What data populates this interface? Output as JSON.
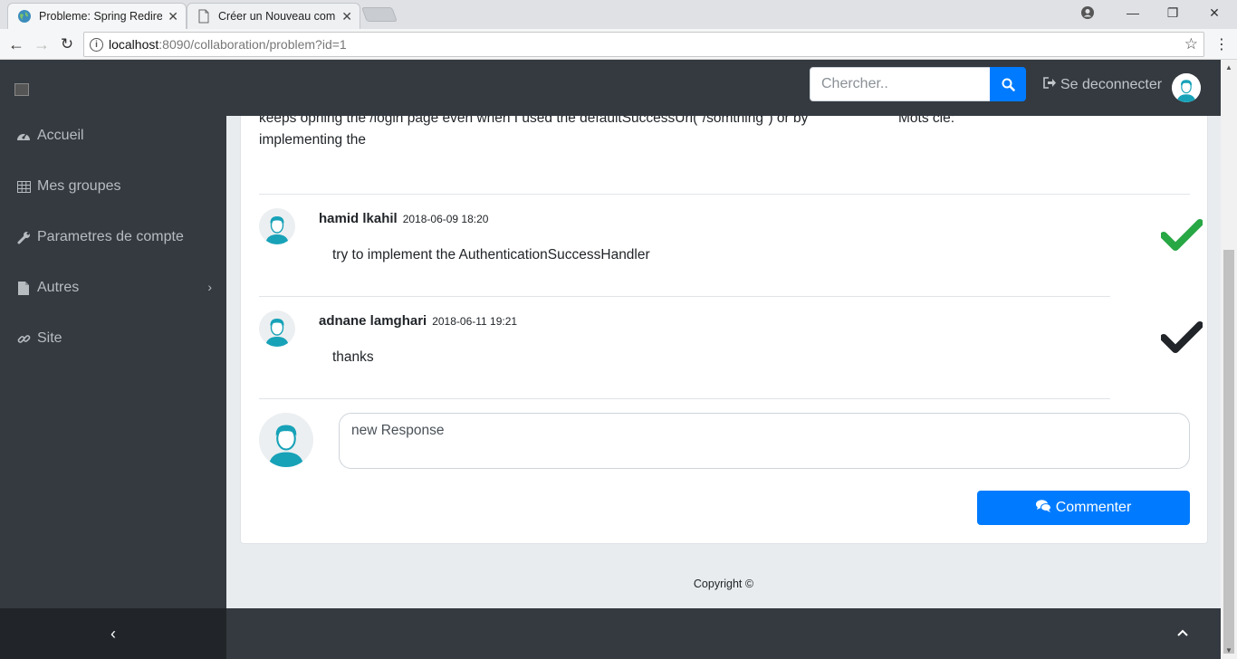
{
  "browser": {
    "tabs": [
      {
        "title": "Probleme: Spring Redirec"
      },
      {
        "title": "Créer un Nouveau compt"
      }
    ],
    "url_host": "localhost",
    "url_path": ":8090/collaboration/problem?id=1"
  },
  "sidebar": {
    "items": [
      {
        "label": "Accueil",
        "icon": "dashboard-icon"
      },
      {
        "label": "Mes groupes",
        "icon": "table-icon"
      },
      {
        "label": "Parametres de compte",
        "icon": "wrench-icon"
      },
      {
        "label": "Autres",
        "icon": "file-icon"
      },
      {
        "label": "Site",
        "icon": "link-icon"
      }
    ]
  },
  "header": {
    "search_placeholder": "Chercher..",
    "logout_label": "Se deconnecter"
  },
  "question": {
    "text_line1": "keeps ophing the /login page even when I used the defaultSuccessUrl(\"/somthing\") or by",
    "text_line2": "implementing the",
    "keywords_label": "Mots clé:"
  },
  "comments": [
    {
      "author": "hamid lkahil",
      "date": "2018-06-09 18:20",
      "text": "try to implement the AuthenticationSuccessHandler",
      "accepted": true
    },
    {
      "author": "adnane lamghari",
      "date": "2018-06-11 19:21",
      "text": "thanks",
      "accepted": false
    }
  ],
  "reply": {
    "value": "new Response",
    "submit_label": "Commenter"
  },
  "footer": {
    "copyright": "Copyright ©"
  },
  "colors": {
    "primary": "#007bff",
    "accepted": "#28a745",
    "not_accepted": "#212529",
    "sidebar_bg": "#343a40",
    "avatar_accent": "#17a2b8"
  }
}
